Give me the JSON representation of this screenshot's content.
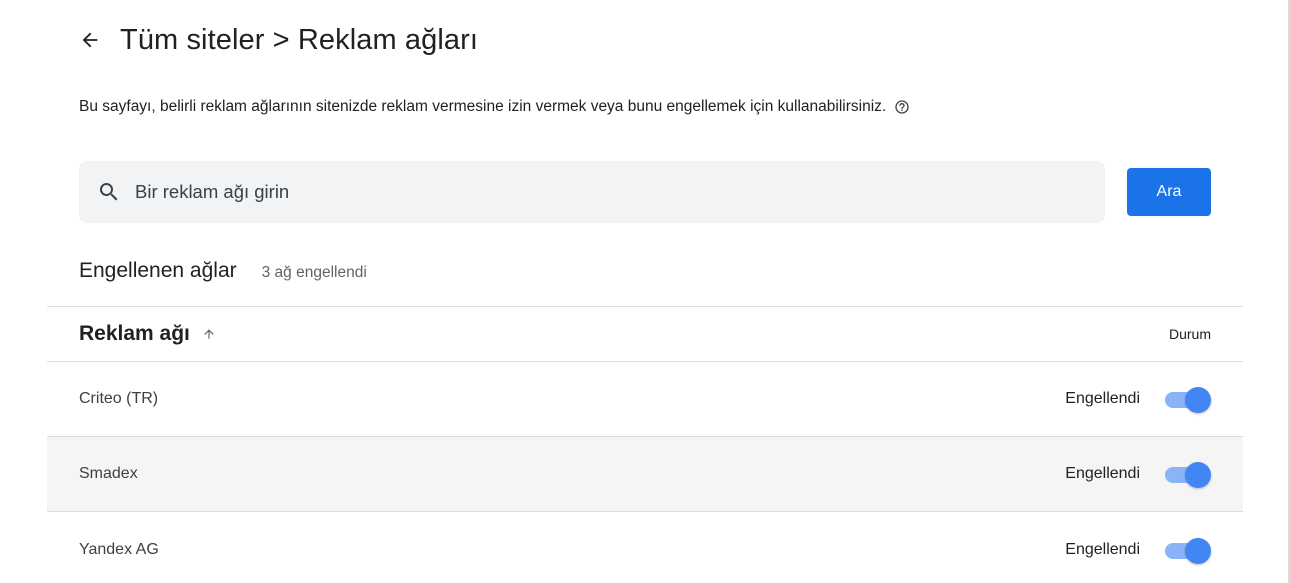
{
  "header": {
    "title": "Tüm siteler > Reklam ağları"
  },
  "description": {
    "text": "Bu sayfayı, belirli reklam ağlarının sitenizde reklam vermesine izin vermek veya bunu engellemek için kullanabilirsiniz.",
    "help_icon": "help-circle-icon"
  },
  "search": {
    "placeholder": "Bir reklam ağı girin",
    "value": "",
    "button_label": "Ara",
    "icon": "search-icon"
  },
  "blocked_section": {
    "title": "Engellenen ağlar",
    "count_text": "3 ağ engellendi"
  },
  "table": {
    "columns": {
      "network": "Reklam ağı",
      "status": "Durum"
    },
    "sort": "ascending",
    "rows": [
      {
        "name": "Criteo (TR)",
        "status": "Engellendi",
        "toggled": true
      },
      {
        "name": "Smadex",
        "status": "Engellendi",
        "toggled": true
      },
      {
        "name": "Yandex AG",
        "status": "Engellendi",
        "toggled": true
      }
    ]
  },
  "colors": {
    "accent": "#1a73e8",
    "toggle_thumb": "#4285f4",
    "toggle_track": "#8ab4f8"
  }
}
